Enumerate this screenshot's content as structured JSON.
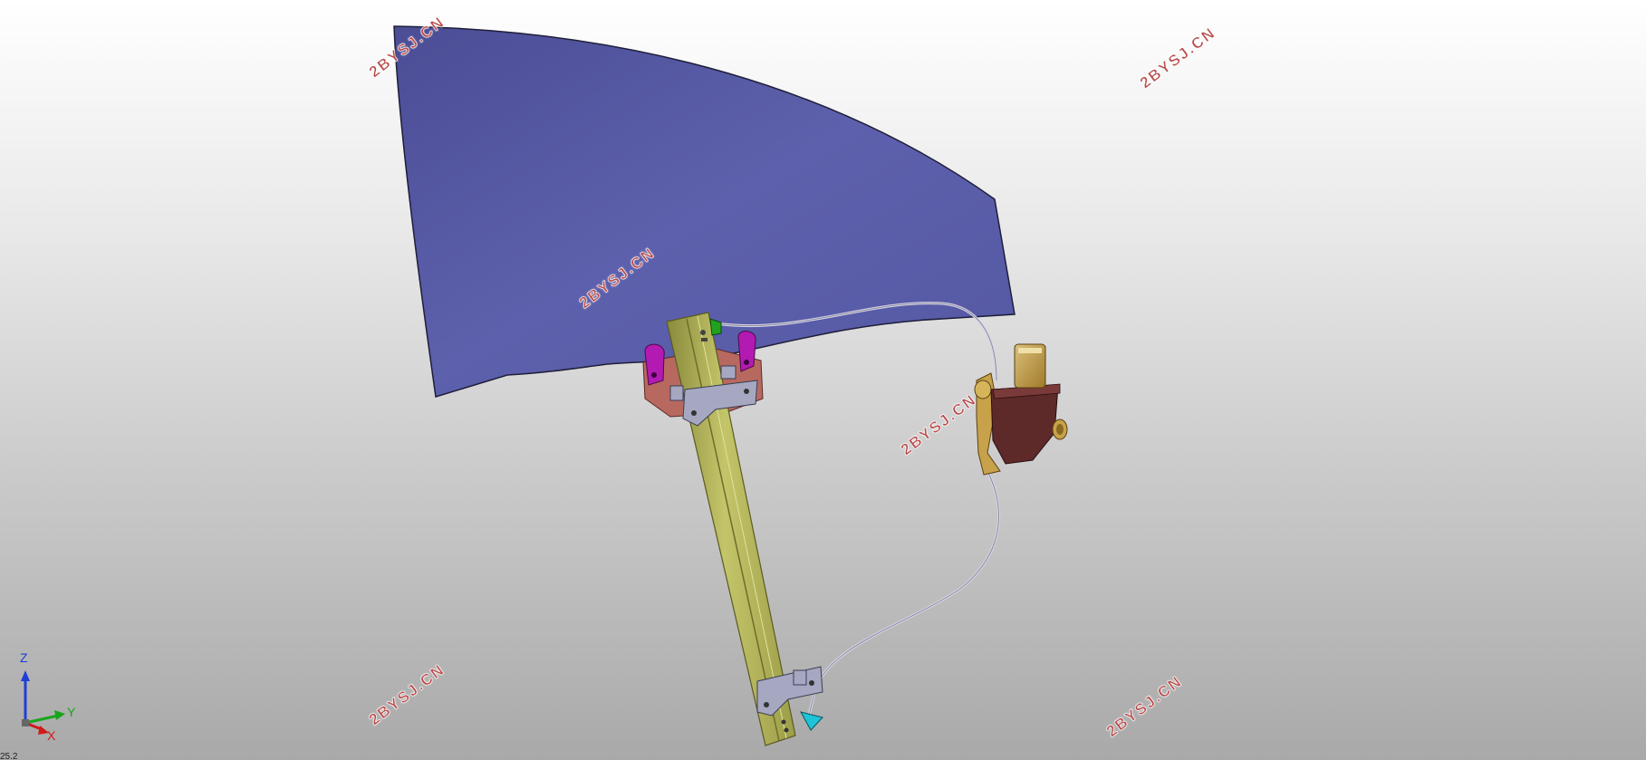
{
  "watermarks": {
    "w1": "2BYSJ.CN",
    "w2": "2BYSJ.CN",
    "w3": "2BYSJ.CN",
    "w4": "2BYSJ.CN",
    "w5": "2BYSJ.CN",
    "w6": "2BYSJ.CN"
  },
  "axis_triad": {
    "z_label": "Z",
    "y_label": "Y",
    "x_label": "X",
    "colors": {
      "z": "#1f3fd6",
      "y": "#17a51a",
      "x": "#d11a1a"
    }
  },
  "status_corner_text": "25.2",
  "scene_colors": {
    "glass": "#5a5da8",
    "rail": "#b7b85a",
    "cable": "#d0d0e0",
    "motor_housing": "#5e2929",
    "motor_body": "#c8a24a",
    "clip_magenta": "#b21ab2",
    "carrier_pink": "#b86a63",
    "bracket_gray": "#a6a8c2",
    "end_cap_cyan": "#1fc2d6",
    "end_cap_green": "#22a022"
  }
}
